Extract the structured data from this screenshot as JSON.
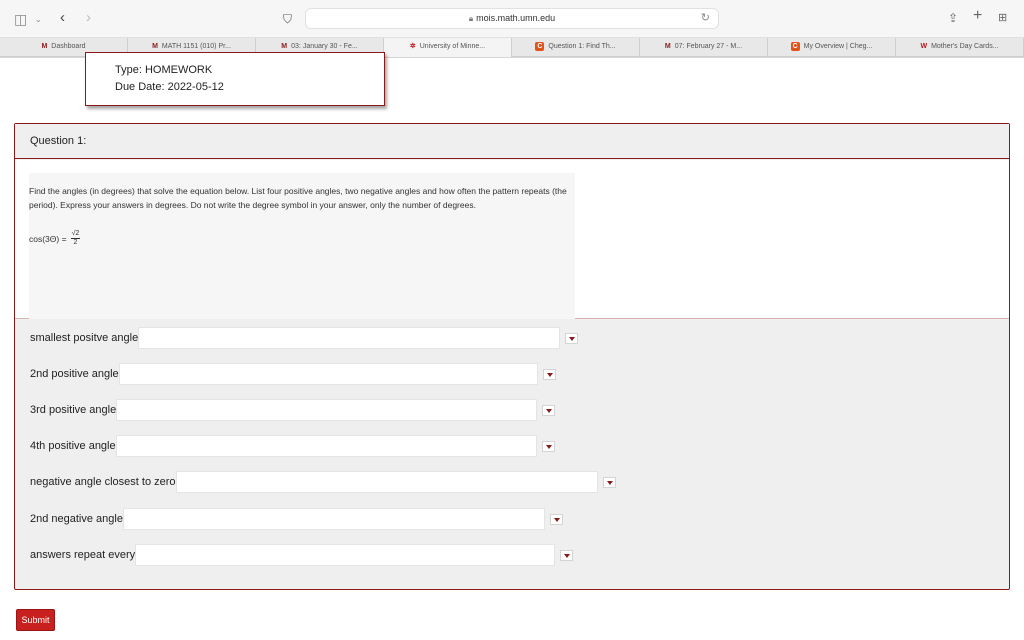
{
  "browser": {
    "url": "mois.math.umn.edu",
    "tabs": [
      {
        "label": "Dashboard",
        "icon": "umn-m-icon"
      },
      {
        "label": "MATH 1151 (010) Pr...",
        "icon": "umn-m-icon"
      },
      {
        "label": "03: January 30 - Fe...",
        "icon": "umn-m-icon"
      },
      {
        "label": "University of Minne...",
        "icon": "umn-seal-icon"
      },
      {
        "label": "Question 1: Find Th...",
        "icon": "chegg-icon"
      },
      {
        "label": "07: February 27 - M...",
        "icon": "umn-m-icon"
      },
      {
        "label": "My Overview | Cheg...",
        "icon": "chegg-icon"
      },
      {
        "label": "Mother's Day Cards...",
        "icon": "walgreens-icon"
      }
    ]
  },
  "assignment": {
    "type_line": "Type: HOMEWORK",
    "due_line": "Due Date: 2022-05-12"
  },
  "question": {
    "header": "Question 1:",
    "prompt": "Find the angles (in degrees) that solve the equation below. List four positive angles, two negative angles and how often the pattern repeats (the period). Express your answers in degrees. Do not write the degree symbol in your answer, only the number of degrees.",
    "equation_lhs": "cos(3Θ) =",
    "equation_num": "√2",
    "equation_den": "2"
  },
  "answers": [
    {
      "label": "smallest positve angle",
      "value": ""
    },
    {
      "label": "2nd positive angle",
      "value": ""
    },
    {
      "label": "3rd positive angle",
      "value": ""
    },
    {
      "label": "4th positive angle",
      "value": ""
    },
    {
      "label": "negative angle closest to zero",
      "value": ""
    },
    {
      "label": "2nd negative angle",
      "value": ""
    },
    {
      "label": "answers repeat every",
      "value": ""
    }
  ],
  "submit_label": "Submit",
  "colors": {
    "accent": "#8a1a1a",
    "submit": "#c8201e"
  }
}
